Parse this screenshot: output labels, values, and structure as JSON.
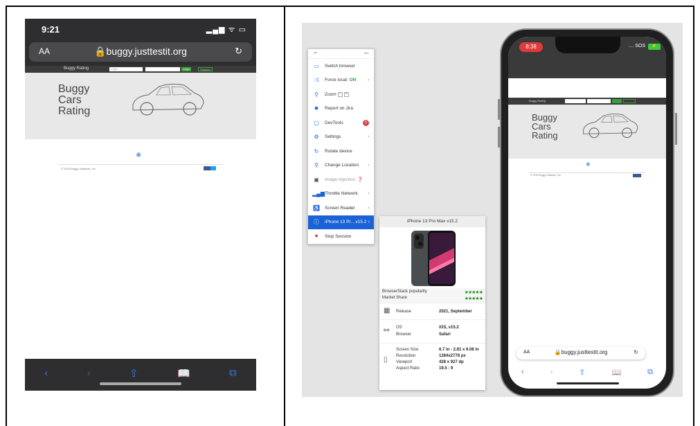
{
  "left_phone": {
    "time": "9:21",
    "status_icons": "▂▄▆ ᯤ ▭",
    "url_aa": "AA",
    "url": "🔒buggy.justtestit.org",
    "reload_icon": "↻",
    "site": {
      "brand": "Buggy Rating",
      "login_placeholder": "Login",
      "login_button": "Login",
      "register_button": "Register",
      "hero_title": "Buggy Cars Rating",
      "footer": "© 2016 Buggy Software, Inc."
    },
    "toolbar": [
      "‹",
      "›",
      "⇧",
      "📖",
      "⧉"
    ]
  },
  "menu": {
    "header_left": "═",
    "header_right": "↤",
    "items": [
      {
        "label": "Switch browser",
        "icon": "monitor-icon"
      },
      {
        "label": "Force local:",
        "value": "ON",
        "icon": "shuffle-icon"
      },
      {
        "label": "Zoom",
        "icon": "zoom-icon"
      },
      {
        "label": "Report on Jira",
        "icon": "bug-icon"
      },
      {
        "label": "DevTools",
        "badge": "0",
        "icon": "window-icon"
      },
      {
        "label": "Settings",
        "icon": "gear-icon"
      },
      {
        "label": "Rotate device",
        "icon": "rotate-icon"
      },
      {
        "label": "Change Location",
        "icon": "location-pin-icon"
      },
      {
        "label": "Image Injection",
        "icon": "image-icon"
      },
      {
        "label": "Throttle Network",
        "icon": "signal-bars-icon"
      },
      {
        "label": "Screen Reader",
        "icon": "accessibility-icon"
      },
      {
        "label": "iPhone 13 Pr....v15.2",
        "icon": "info-icon"
      },
      {
        "label": "Stop Session",
        "icon": "stop-icon"
      }
    ]
  },
  "device_card": {
    "title": "iPhone 13 Pro Max v15.2",
    "popularity_label": "BrowserStack popularity",
    "market_share_label": "Market Share",
    "stars": "★★★★★",
    "release_label": "Release",
    "release_value": "2021, September",
    "os_label": "OS",
    "os_value": "iOS, v15.2",
    "browser_label": "Browser",
    "browser_value": "Safari",
    "screen_size_label": "Screen Size",
    "screen_size_value": "6.7 in - 2.81 x 6.08 in",
    "resolution_label": "Resolution",
    "resolution_value": "1284x2778 px",
    "viewport_label": "Viewport",
    "viewport_value": "428 x 927 dp",
    "aspect_label": "Aspect Ratio",
    "aspect_value": "19.5 : 9"
  },
  "right_phone": {
    "time": "8:38",
    "sos": ".... SOS",
    "battery": "⚡",
    "site_hero_title": "Buggy Cars Rating",
    "url_aa": "AA",
    "url": "🔒buggy.justtestit.org",
    "reload_icon": "↻",
    "toolbar": [
      "‹",
      "›",
      "⇧",
      "📖",
      "⧉"
    ]
  },
  "colors": {
    "accent": "#1a62d6",
    "green": "#3aa03a",
    "danger": "#d64545"
  }
}
